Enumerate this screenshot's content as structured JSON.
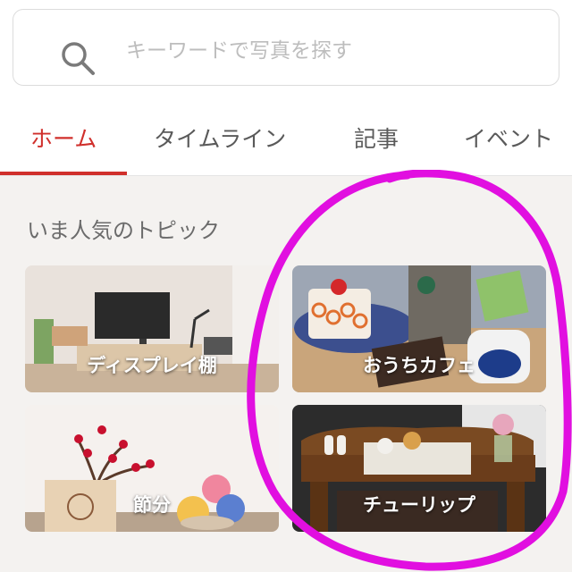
{
  "search": {
    "placeholder": "キーワードで写真を探す"
  },
  "tabs": [
    {
      "label": "ホーム",
      "active": true
    },
    {
      "label": "タイムライン",
      "active": false
    },
    {
      "label": "記事",
      "active": false
    },
    {
      "label": "イベント",
      "active": false
    }
  ],
  "section": {
    "title": "いま人気のトピック"
  },
  "topics": [
    {
      "label": "ディスプレイ棚"
    },
    {
      "label": "おうちカフェ"
    },
    {
      "label": "節分"
    },
    {
      "label": "チューリップ"
    }
  ],
  "colors": {
    "accent": "#d0302c",
    "annotation": "#e10fe0"
  }
}
